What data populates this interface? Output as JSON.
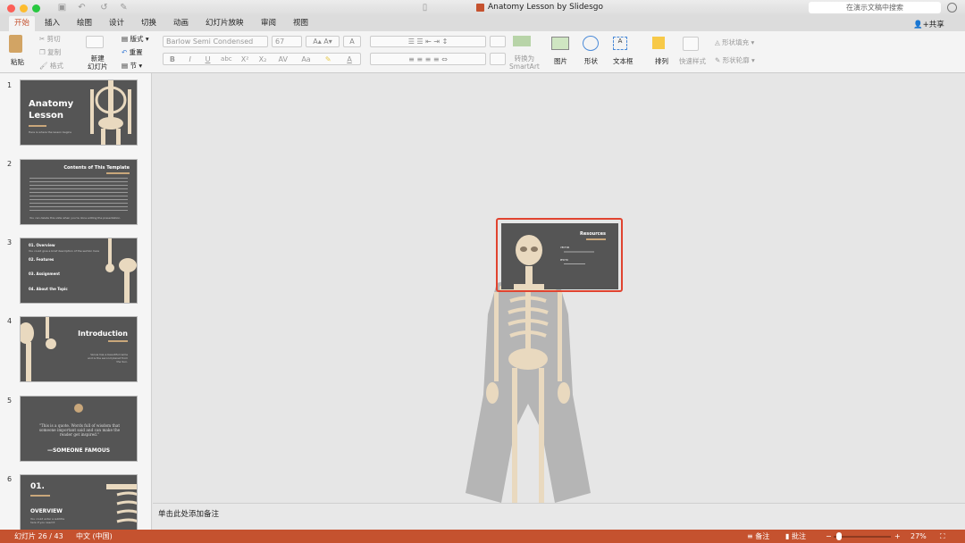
{
  "window": {
    "title": "Anatomy Lesson by Slidesgo",
    "search_placeholder": "在演示文稿中搜索",
    "share_label": "共享"
  },
  "tabs": [
    {
      "label": "开始",
      "active": true
    },
    {
      "label": "插入"
    },
    {
      "label": "绘图"
    },
    {
      "label": "设计"
    },
    {
      "label": "切换"
    },
    {
      "label": "动画"
    },
    {
      "label": "幻灯片放映"
    },
    {
      "label": "审阅"
    },
    {
      "label": "视图"
    }
  ],
  "ribbon": {
    "paste": "粘贴",
    "cut": "剪切",
    "copy": "复制",
    "format": "格式",
    "new_slide": "新建\n幻灯片",
    "layout": "版式",
    "reset": "重置",
    "section": "节",
    "font_name": "Barlow Semi Condensed",
    "font_size": "67",
    "bold": "B",
    "italic": "I",
    "underline": "U",
    "strike": "abc",
    "superscript": "X²",
    "subscript": "X₂",
    "convert_smartart_1": "转换为",
    "convert_smartart_2": "SmartArt",
    "picture": "图片",
    "shapes": "形状",
    "textbox": "文本框",
    "arrange": "排列",
    "quick_styles": "快速样式",
    "shape_fill": "形状填充",
    "shape_outline": "形状轮廓"
  },
  "slides": [
    {
      "num": "1",
      "title": "Anatomy Lesson",
      "subtitle": "Here is where the lesson begins"
    },
    {
      "num": "2",
      "title": "Contents of This Template",
      "subtitle": "You can delete this slide when you're done editing the presentation."
    },
    {
      "num": "3",
      "items": [
        "01. Overview",
        "02. Features",
        "03. Assignment",
        "04. About the Topic"
      ],
      "subtitle": "You could give a brief description of the section here"
    },
    {
      "num": "4",
      "title": "Introduction",
      "subtitle": "Venus has a beautiful name and is the second planet from the Sun."
    },
    {
      "num": "5",
      "quote": "\"This is a quote. Words full of wisdom that someone important said and can make the reader get inspired.\"",
      "author": "—SOMEONE FAMOUS"
    },
    {
      "num": "6",
      "number": "01.",
      "title": "OVERVIEW",
      "subtitle": "You could enter a subtitle here if you need it"
    }
  ],
  "current_slide": {
    "title": "Resources",
    "section1": "VECTOR",
    "section2": "PHOTO"
  },
  "notes_placeholder": "单击此处添加备注",
  "status": {
    "slide_counter": "幻灯片 26 / 43",
    "language": "中文 (中国)",
    "notes": "备注",
    "comments": "批注",
    "zoom": "27%",
    "zoom_value": 27
  },
  "colors": {
    "accent": "#c5522f",
    "slide_bg": "#555555",
    "bone": "#e9d9bf",
    "gold": "#c9a77b",
    "selection": "#e0432f"
  }
}
